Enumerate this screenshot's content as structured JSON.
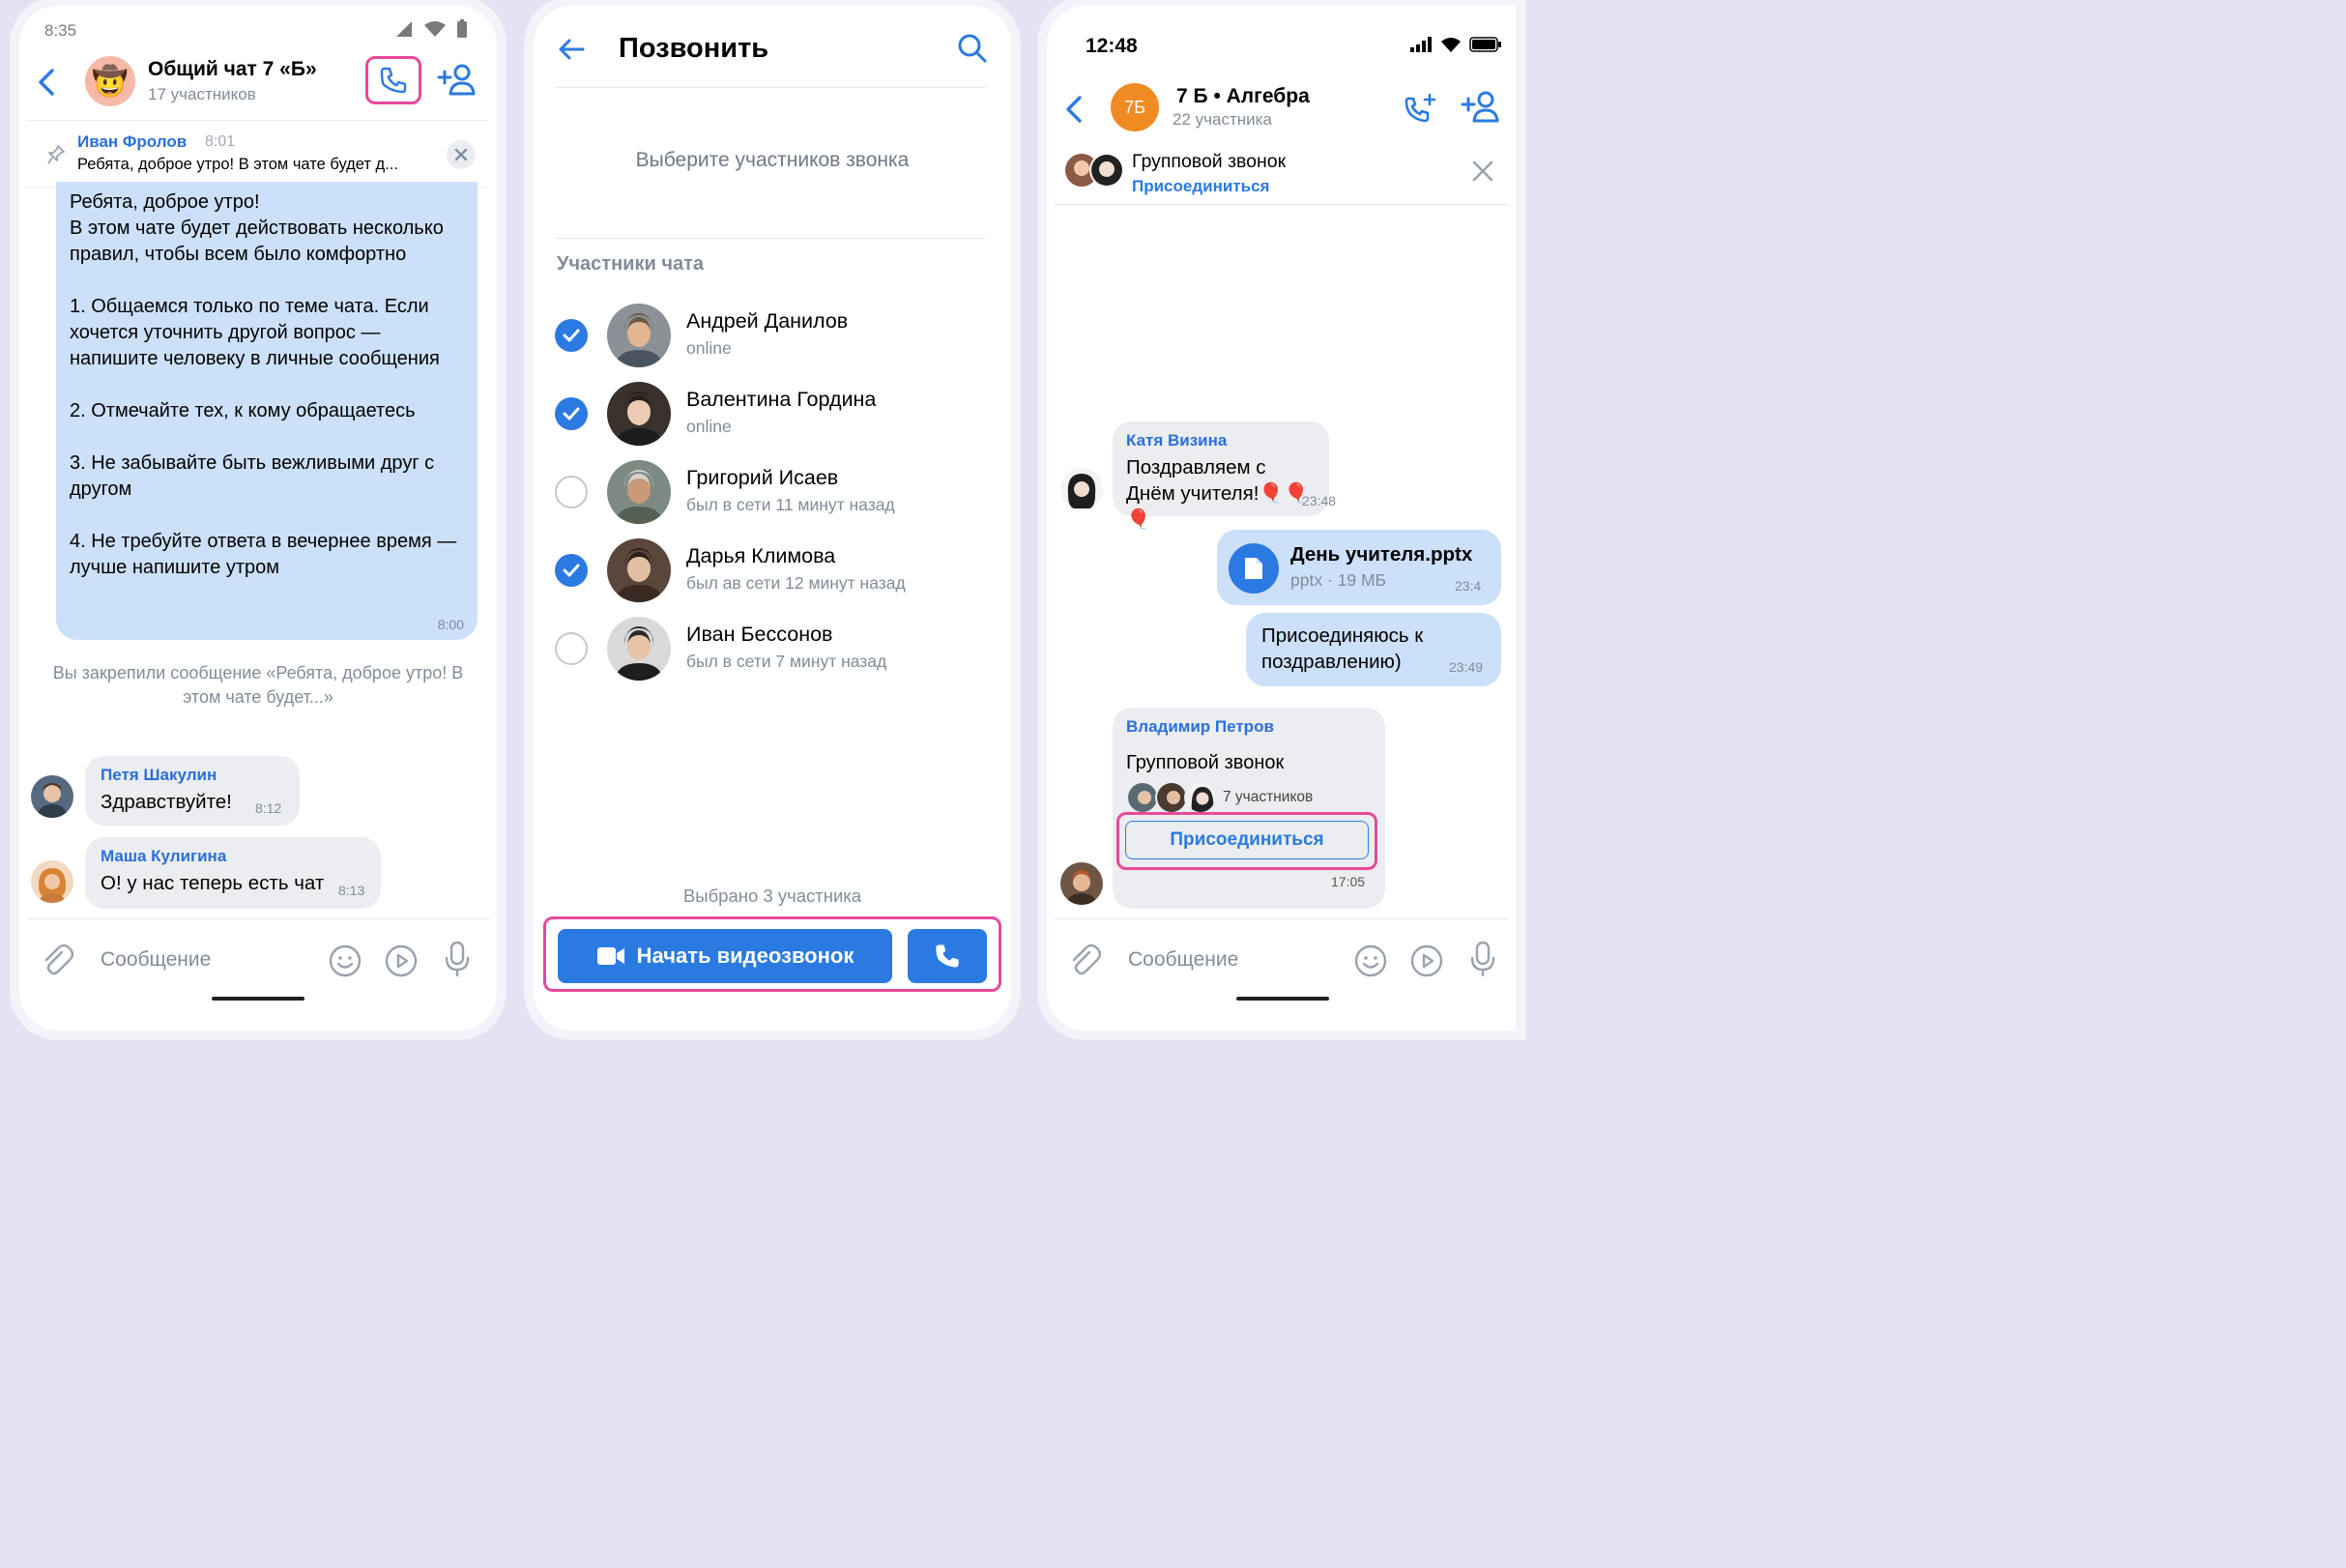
{
  "accent": "#2a7ae2",
  "highlight": "#e8489a",
  "screen1": {
    "status_time": "8:35",
    "chat_title": "Общий чат 7 «Б»",
    "chat_subtitle": "17 участников",
    "pinned": {
      "author": "Иван Фролов",
      "time": "8:01",
      "text": "Ребята, доброе утро! В этом чате будет д..."
    },
    "pinned_message": {
      "text": "Ребята, доброе утро!\nВ этом чате будет действовать несколько правил, чтобы всем было комфортно\n\n1. Общаемся только по теме чата. Если хочется уточнить другой вопрос — напишите человеку в личные сообщения\n\n2. Отмечайте тех, к кому обращаетесь\n\n3. Не забывайте быть вежливыми друг с другом\n\n4. Не требуйте ответа в вечернее время — лучше напишите утром",
      "time": "8:00"
    },
    "system_message": "Вы закрепили сообщение «Ребята, доброе утро! В этом чате будет...»",
    "messages": [
      {
        "author": "Петя Шакулин",
        "text": "Здравствуйте!",
        "time": "8:12"
      },
      {
        "author": "Маша Кулигина",
        "text": "О! у нас теперь есть чат",
        "time": "8:13"
      }
    ],
    "input_placeholder": "Сообщение"
  },
  "screen2": {
    "title": "Позвонить",
    "hint": "Выберите участников звонка",
    "section_label": "Участники чата",
    "contacts": [
      {
        "name": "Андрей Данилов",
        "status": "online",
        "selected": true
      },
      {
        "name": "Валентина Гордина",
        "status": "online",
        "selected": true
      },
      {
        "name": "Григорий Исаев",
        "status": "был в сети 11 минут назад",
        "selected": false
      },
      {
        "name": "Дарья Климова",
        "status": "был ав сети 12 минут назад",
        "selected": true
      },
      {
        "name": "Иван Бессонов",
        "status": "был в сети 7 минут назад",
        "selected": false
      }
    ],
    "selected_count": "Выбрано 3 участника",
    "video_button": "Начать видеозвонок"
  },
  "screen3": {
    "status_time": "12:48",
    "avatar_label": "7Б",
    "chat_title": "7 Б • Алгебра",
    "chat_subtitle": "22 участника",
    "banner": {
      "title": "Групповой звонок",
      "join": "Присоединиться"
    },
    "msg1": {
      "author": "Катя Визина",
      "text": "Поздравляем с Днём учителя!🎈🎈🎈",
      "time": "23:48"
    },
    "file": {
      "name": "День учителя.pptx",
      "meta": "pptx · 19 МБ",
      "time": "23:4"
    },
    "msg2": {
      "text": "Присоединяюсь к поздравлению)",
      "time": "23:49"
    },
    "call_card": {
      "author": "Владимир Петров",
      "title": "Групповой звонок",
      "participants": "7 участников",
      "join_button": "Присоединиться",
      "time": "17:05"
    },
    "input_placeholder": "Сообщение"
  }
}
